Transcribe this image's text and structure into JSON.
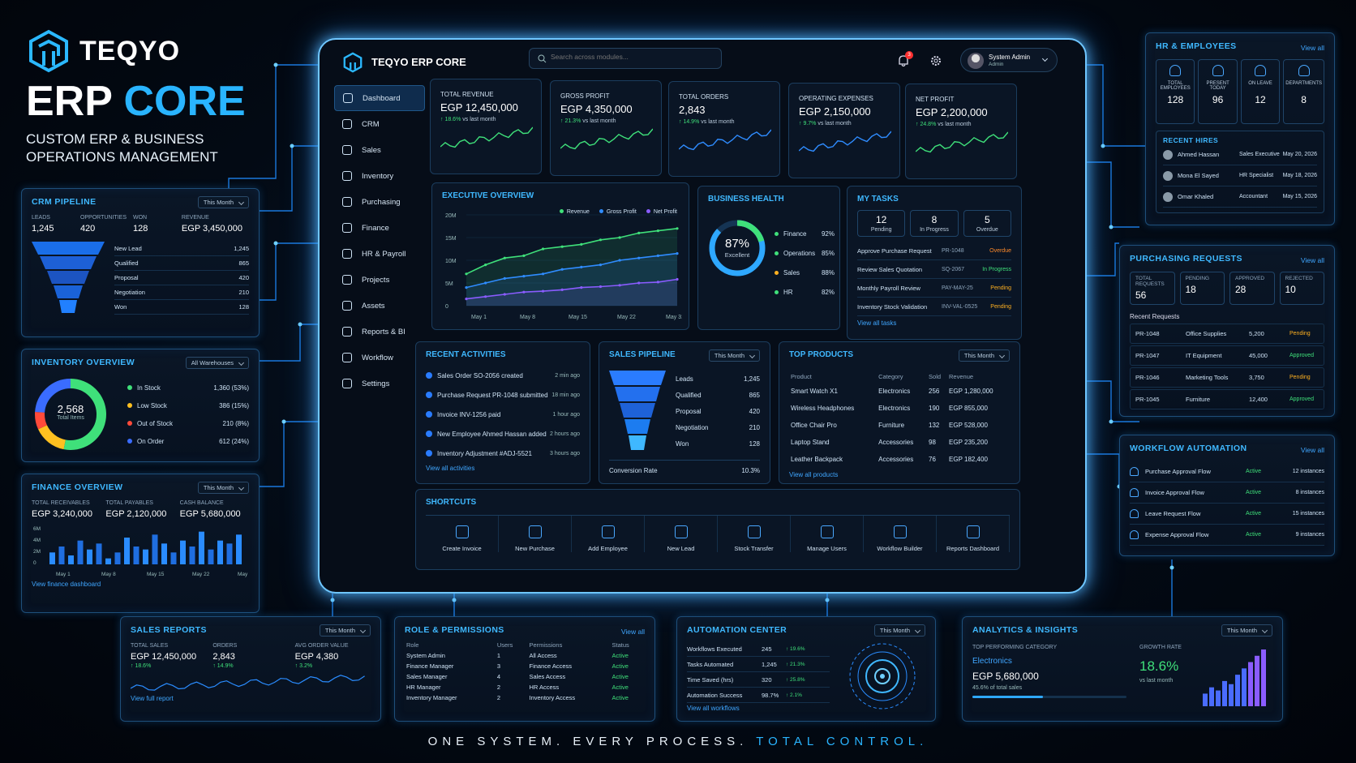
{
  "brand": {
    "logo_text": "TEQYO",
    "headline_1": "ERP",
    "headline_2": "CORE",
    "subtitle_1": "CUSTOM ERP & BUSINESS",
    "subtitle_2": "OPERATIONS MANAGEMENT",
    "tagline_1": "ONE SYSTEM. EVERY PROCESS.",
    "tagline_2": "TOTAL CONTROL."
  },
  "app": {
    "title": "TEQYO ERP CORE",
    "search_placeholder": "Search across modules...",
    "notif_count": "3",
    "user_name": "System Admin",
    "user_role": "Admin"
  },
  "nav": [
    {
      "label": "Dashboard",
      "icon": "home-icon"
    },
    {
      "label": "CRM",
      "icon": "crm-icon"
    },
    {
      "label": "Sales",
      "icon": "cart-icon"
    },
    {
      "label": "Inventory",
      "icon": "box-icon"
    },
    {
      "label": "Purchasing",
      "icon": "purchase-icon"
    },
    {
      "label": "Finance",
      "icon": "finance-icon"
    },
    {
      "label": "HR & Payroll",
      "icon": "people-icon"
    },
    {
      "label": "Projects",
      "icon": "projects-icon"
    },
    {
      "label": "Assets",
      "icon": "assets-icon"
    },
    {
      "label": "Reports & BI",
      "icon": "chart-icon"
    },
    {
      "label": "Workflow",
      "icon": "workflow-icon"
    },
    {
      "label": "Settings",
      "icon": "gear-icon"
    }
  ],
  "kpis": [
    {
      "label": "TOTAL REVENUE",
      "value": "EGP 12,450,000",
      "change": "↑ 18.6%",
      "note": "vs last month",
      "color": "#3fe07a"
    },
    {
      "label": "GROSS PROFIT",
      "value": "EGP 4,350,000",
      "change": "↑ 21.3%",
      "note": "vs last month",
      "color": "#3fe07a"
    },
    {
      "label": "TOTAL ORDERS",
      "value": "2,843",
      "change": "↑ 14.9%",
      "note": "vs last month",
      "color": "#2f8cff"
    },
    {
      "label": "OPERATING EXPENSES",
      "value": "EGP 2,150,000",
      "change": "↑ 9.7%",
      "note": "vs last month",
      "color": "#2f8cff"
    },
    {
      "label": "NET PROFIT",
      "value": "EGP 2,200,000",
      "change": "↑ 24.8%",
      "note": "vs last month",
      "color": "#3fe07a"
    }
  ],
  "exec": {
    "title": "EXECUTIVE OVERVIEW",
    "legend": [
      "Revenue",
      "Gross Profit",
      "Net Profit"
    ]
  },
  "chart_data": {
    "type": "line",
    "x": [
      "May 1",
      "May 8",
      "May 15",
      "May 22",
      "May 31"
    ],
    "yticks": [
      "20M",
      "15M",
      "10M",
      "5M",
      "0"
    ],
    "ylim": [
      0,
      20
    ],
    "series": [
      {
        "name": "Revenue",
        "color": "#3fe07a",
        "values": [
          7,
          9,
          10.5,
          11,
          12.5,
          13,
          13.5,
          14.5,
          15,
          16,
          16.5,
          17
        ]
      },
      {
        "name": "Gross Profit",
        "color": "#2f8cff",
        "values": [
          4,
          5,
          6,
          6.5,
          7,
          8,
          8.5,
          9,
          10,
          10.5,
          11,
          11.5
        ]
      },
      {
        "name": "Net Profit",
        "color": "#8a5cff",
        "values": [
          1.5,
          2,
          2.5,
          3,
          3.2,
          3.5,
          4,
          4.2,
          4.5,
          5,
          5.2,
          5.8
        ]
      }
    ]
  },
  "health": {
    "title": "BUSINESS HEALTH",
    "pct": "87%",
    "status": "Excellent",
    "items": [
      {
        "label": "Finance",
        "value": "92%",
        "color": "#3fe07a"
      },
      {
        "label": "Operations",
        "value": "85%",
        "color": "#3fe07a"
      },
      {
        "label": "Sales",
        "value": "88%",
        "color": "#ffb020"
      },
      {
        "label": "HR",
        "value": "82%",
        "color": "#3fe07a"
      }
    ]
  },
  "tasks": {
    "title": "MY TASKS",
    "counts": [
      {
        "n": "12",
        "label": "Pending"
      },
      {
        "n": "8",
        "label": "In Progress"
      },
      {
        "n": "5",
        "label": "Overdue"
      }
    ],
    "items": [
      {
        "name": "Approve Purchase Request",
        "ref": "PR-1048",
        "status": "Overdue",
        "color": "#ff8a2a"
      },
      {
        "name": "Review Sales Quotation",
        "ref": "SQ-2067",
        "status": "In Progress",
        "color": "#3fe07a"
      },
      {
        "name": "Monthly Payroll Review",
        "ref": "PAY-MAY-25",
        "status": "Pending",
        "color": "#ffb020"
      },
      {
        "name": "Inventory Stock Validation",
        "ref": "INV-VAL-0525",
        "status": "Pending",
        "color": "#ffb020"
      }
    ],
    "link": "View all tasks"
  },
  "activities": {
    "title": "RECENT ACTIVITIES",
    "items": [
      {
        "text": "Sales Order SO-2056 created",
        "time": "2 min ago"
      },
      {
        "text": "Purchase Request PR-1048 submitted",
        "time": "18 min ago"
      },
      {
        "text": "Invoice INV-1256 paid",
        "time": "1 hour ago"
      },
      {
        "text": "New Employee Ahmed Hassan added",
        "time": "2 hours ago"
      },
      {
        "text": "Inventory Adjustment #ADJ-5521",
        "time": "3 hours ago"
      }
    ],
    "link": "View all activities"
  },
  "salespipe": {
    "title": "SALES PIPELINE",
    "filter": "This Month",
    "stages": [
      {
        "label": "Leads",
        "value": "1,245"
      },
      {
        "label": "Qualified",
        "value": "865"
      },
      {
        "label": "Proposal",
        "value": "420"
      },
      {
        "label": "Negotiation",
        "value": "210"
      },
      {
        "label": "Won",
        "value": "128"
      }
    ],
    "conv_label": "Conversion Rate",
    "conv": "10.3%"
  },
  "topproducts": {
    "title": "TOP PRODUCTS",
    "filter": "This Month",
    "headers": [
      "Product",
      "Category",
      "Sold",
      "Revenue"
    ],
    "rows": [
      [
        "Smart Watch X1",
        "Electronics",
        "256",
        "EGP 1,280,000"
      ],
      [
        "Wireless Headphones",
        "Electronics",
        "190",
        "EGP 855,000"
      ],
      [
        "Office Chair Pro",
        "Furniture",
        "132",
        "EGP 528,000"
      ],
      [
        "Laptop Stand",
        "Accessories",
        "98",
        "EGP 235,200"
      ],
      [
        "Leather Backpack",
        "Accessories",
        "76",
        "EGP 182,400"
      ]
    ],
    "link": "View all products"
  },
  "shortcuts": {
    "title": "SHORTCUTS",
    "items": [
      "Create Invoice",
      "New Purchase",
      "Add Employee",
      "New Lead",
      "Stock Transfer",
      "Manage Users",
      "Workflow Builder",
      "Reports Dashboard"
    ]
  },
  "crm": {
    "title": "CRM PIPELINE",
    "filter": "This Month",
    "kpis": [
      {
        "label": "LEADS",
        "value": "1,245"
      },
      {
        "label": "OPPORTUNITIES",
        "value": "420"
      },
      {
        "label": "WON",
        "value": "128"
      },
      {
        "label": "REVENUE",
        "value": "EGP 3,450,000"
      }
    ],
    "stages": [
      {
        "label": "New Lead",
        "value": "1,245"
      },
      {
        "label": "Qualified",
        "value": "865"
      },
      {
        "label": "Proposal",
        "value": "420"
      },
      {
        "label": "Negotiation",
        "value": "210"
      },
      {
        "label": "Won",
        "value": "128"
      }
    ]
  },
  "inventory": {
    "title": "INVENTORY OVERVIEW",
    "filter": "All Warehouses",
    "total": "2,568",
    "total_label": "Total Items",
    "items": [
      {
        "label": "In Stock",
        "value": "1,360 (53%)",
        "color": "#3fe07a",
        "pct": 53
      },
      {
        "label": "Low Stock",
        "value": "386 (15%)",
        "color": "#ffc020",
        "pct": 15
      },
      {
        "label": "Out of Stock",
        "value": "210 (8%)",
        "color": "#ff4a3a",
        "pct": 8
      },
      {
        "label": "On Order",
        "value": "612 (24%)",
        "color": "#3a6cff",
        "pct": 24
      }
    ]
  },
  "finance": {
    "title": "FINANCE OVERVIEW",
    "filter": "This Month",
    "kpis": [
      {
        "label": "TOTAL RECEIVABLES",
        "value": "EGP 3,240,000"
      },
      {
        "label": "TOTAL PAYABLES",
        "value": "EGP 2,120,000"
      },
      {
        "label": "CASH BALANCE",
        "value": "EGP 5,680,000"
      }
    ],
    "yticks": [
      "6M",
      "4M",
      "2M",
      "0"
    ],
    "xticks": [
      "May 1",
      "May 8",
      "May 15",
      "May 22",
      "May 31"
    ],
    "bars": [
      2,
      3,
      1.5,
      4,
      2.5,
      3.5,
      1,
      2,
      4.5,
      3,
      2.5,
      5,
      3.5,
      2,
      4,
      3,
      5.5,
      2.5,
      4,
      3.5,
      5
    ],
    "link": "View finance dashboard"
  },
  "hr": {
    "title": "HR & EMPLOYEES",
    "link": "View all",
    "stats": [
      {
        "label": "TOTAL EMPLOYEES",
        "value": "128"
      },
      {
        "label": "PRESENT TODAY",
        "value": "96"
      },
      {
        "label": "ON LEAVE",
        "value": "12"
      },
      {
        "label": "DEPARTMENTS",
        "value": "8"
      }
    ],
    "hires_title": "RECENT HIRES",
    "hires": [
      {
        "name": "Ahmed Hassan",
        "role": "Sales Executive",
        "date": "May 20, 2026"
      },
      {
        "name": "Mona El Sayed",
        "role": "HR Specialist",
        "date": "May 18, 2026"
      },
      {
        "name": "Omar Khaled",
        "role": "Accountant",
        "date": "May 15, 2026"
      }
    ]
  },
  "purchasing": {
    "title": "PURCHASING REQUESTS",
    "link": "View all",
    "stats": [
      {
        "label": "TOTAL REQUESTS",
        "value": "56"
      },
      {
        "label": "PENDING",
        "value": "18"
      },
      {
        "label": "APPROVED",
        "value": "28"
      },
      {
        "label": "REJECTED",
        "value": "10"
      }
    ],
    "recent_title": "Recent Requests",
    "rows": [
      {
        "id": "PR-1048",
        "item": "Office Supplies",
        "amount": "5,200",
        "status": "Pending",
        "color": "#ffb020"
      },
      {
        "id": "PR-1047",
        "item": "IT Equipment",
        "amount": "45,000",
        "status": "Approved",
        "color": "#3fe07a"
      },
      {
        "id": "PR-1046",
        "item": "Marketing Tools",
        "amount": "3,750",
        "status": "Pending",
        "color": "#ffb020"
      },
      {
        "id": "PR-1045",
        "item": "Furniture",
        "amount": "12,400",
        "status": "Approved",
        "color": "#3fe07a"
      }
    ]
  },
  "workflow": {
    "title": "WORKFLOW AUTOMATION",
    "link": "View all",
    "rows": [
      {
        "name": "Purchase Approval Flow",
        "status": "Active",
        "count": "12 instances"
      },
      {
        "name": "Invoice Approval Flow",
        "status": "Active",
        "count": "8 instances"
      },
      {
        "name": "Leave Request Flow",
        "status": "Active",
        "count": "15 instances"
      },
      {
        "name": "Expense Approval Flow",
        "status": "Active",
        "count": "9 instances"
      }
    ]
  },
  "salesreports": {
    "title": "SALES REPORTS",
    "filter": "This Month",
    "kpis": [
      {
        "label": "TOTAL SALES",
        "value": "EGP 12,450,000",
        "change": "↑ 18.6%"
      },
      {
        "label": "ORDERS",
        "value": "2,843",
        "change": "↑ 14.9%"
      },
      {
        "label": "AVG ORDER VALUE",
        "value": "EGP 4,380",
        "change": "↑ 3.2%"
      }
    ],
    "link": "View full report"
  },
  "roles": {
    "title": "ROLE & PERMISSIONS",
    "link": "View all",
    "headers": [
      "Role",
      "Users",
      "Permissions",
      "Status"
    ],
    "rows": [
      [
        "System Admin",
        "1",
        "All Access",
        "Active"
      ],
      [
        "Finance Manager",
        "3",
        "Finance Access",
        "Active"
      ],
      [
        "Sales Manager",
        "4",
        "Sales Access",
        "Active"
      ],
      [
        "HR Manager",
        "2",
        "HR Access",
        "Active"
      ],
      [
        "Inventory Manager",
        "2",
        "Inventory Access",
        "Active"
      ]
    ]
  },
  "automation": {
    "title": "AUTOMATION CENTER",
    "filter": "This Month",
    "rows": [
      {
        "label": "Workflows Executed",
        "value": "245",
        "change": "↑ 19.6%"
      },
      {
        "label": "Tasks Automated",
        "value": "1,245",
        "change": "↑ 21.3%"
      },
      {
        "label": "Time Saved (hrs)",
        "value": "320",
        "change": "↑ 25.8%"
      },
      {
        "label": "Automation Success",
        "value": "98.7%",
        "change": "↑ 2.1%"
      }
    ],
    "link": "View all workflows"
  },
  "analytics": {
    "title": "ANALYTICS & INSIGHTS",
    "filter": "This Month",
    "cat_label": "TOP PERFORMING CATEGORY",
    "cat": "Electronics",
    "cat_value": "EGP 5,680,000",
    "cat_note": "45.6% of total sales",
    "cat_share": 0.456,
    "growth_label": "GROWTH RATE",
    "growth": "18.6%",
    "growth_note": "vs last month",
    "bars": [
      2,
      3,
      2.5,
      4,
      3.5,
      5,
      6,
      7,
      8,
      9
    ]
  }
}
